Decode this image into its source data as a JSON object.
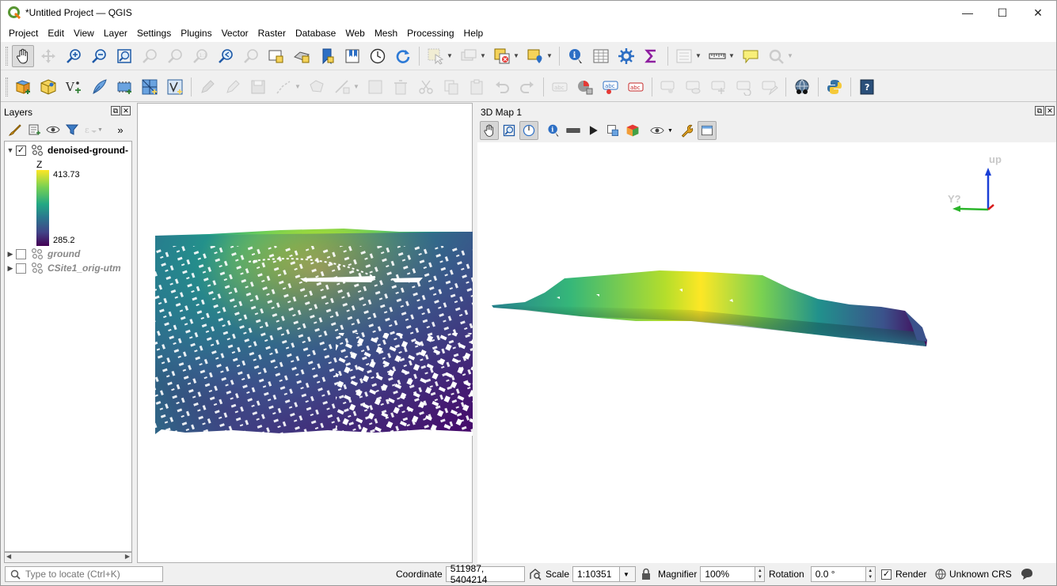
{
  "window": {
    "title": "*Untitled Project — QGIS",
    "minimize": "—",
    "maximize": "☐",
    "close": "✕"
  },
  "menubar": [
    {
      "label": "Project"
    },
    {
      "label": "Edit"
    },
    {
      "label": "View"
    },
    {
      "label": "Layer"
    },
    {
      "label": "Settings"
    },
    {
      "label": "Plugins"
    },
    {
      "label": "Vector"
    },
    {
      "label": "Raster"
    },
    {
      "label": "Database"
    },
    {
      "label": "Web"
    },
    {
      "label": "Mesh"
    },
    {
      "label": "Processing"
    },
    {
      "label": "Help"
    }
  ],
  "layers_panel": {
    "title": "Layers",
    "layers": [
      {
        "name": "denoised-ground-",
        "checked": true,
        "expanded": true
      },
      {
        "name": "ground",
        "checked": false,
        "expanded": false
      },
      {
        "name": "CSite1_orig-utm",
        "checked": false,
        "expanded": false
      }
    ],
    "legend": {
      "attribute": "Z",
      "max": "413.73",
      "min": "285.2"
    }
  },
  "map3d": {
    "title": "3D Map 1",
    "axis_up": "up",
    "axis_y": "Y?"
  },
  "statusbar": {
    "locator_placeholder": "Type to locate (Ctrl+K)",
    "coordinate_label": "Coordinate",
    "coordinate_value": "511987, 5404214",
    "scale_label": "Scale",
    "scale_value": "1:10351",
    "magnifier_label": "Magnifier",
    "magnifier_value": "100%",
    "rotation_label": "Rotation",
    "rotation_value": "0.0 °",
    "render_label": "Render",
    "render_checked": true,
    "crs_label": "Unknown CRS"
  },
  "colors": {
    "viridis_low": "#440154",
    "viridis_mid": "#21918c",
    "viridis_high": "#fde725",
    "title_bg": "#ffffff",
    "chrome_bg": "#f0f0f0"
  }
}
